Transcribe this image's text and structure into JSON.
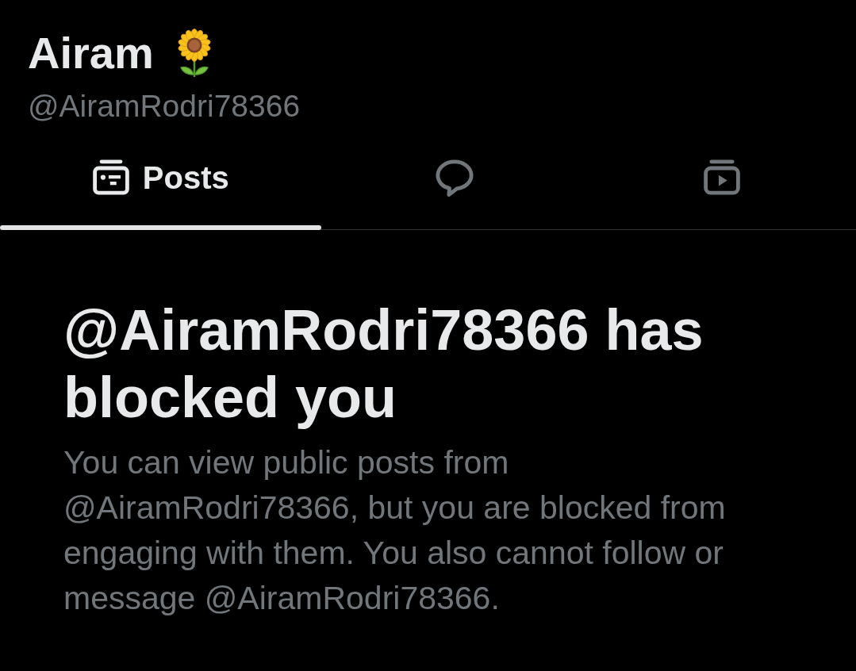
{
  "profile": {
    "name": "Airam",
    "handle": "@AiramRodri78366"
  },
  "tabs": [
    {
      "kind": "card",
      "label": "Posts",
      "selected": true
    },
    {
      "kind": "bubble",
      "selected": false
    },
    {
      "kind": "play",
      "selected": false
    }
  ],
  "notice": {
    "title": "@AiramRodri78366 has blocked you",
    "message": "You can view public posts from @AiramRodri78366, but you are blocked from engaging with them. You also cannot follow or message @AiramRodri78366."
  }
}
